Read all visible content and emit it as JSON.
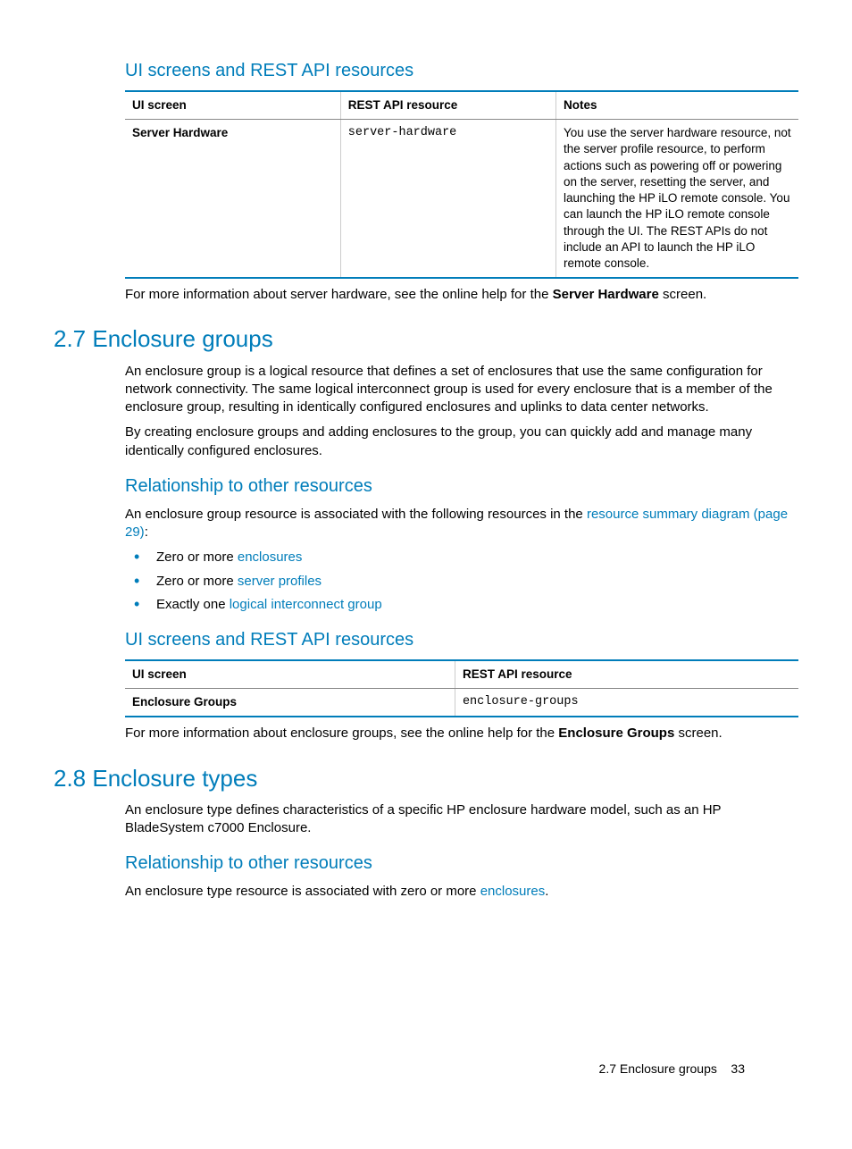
{
  "section_a": {
    "heading": "UI screens and REST API resources",
    "table": {
      "headers": [
        "UI screen",
        "REST API resource",
        "Notes"
      ],
      "row": {
        "ui": "Server Hardware",
        "api": "server-hardware",
        "notes": "You use the server hardware resource, not the server profile resource, to perform actions such as powering off or powering on the server, resetting the server, and launching the HP iLO remote console. You can launch the HP iLO remote console through the UI. The REST APIs do not include an API to launch the HP iLO remote console."
      }
    },
    "para_pre": "For more information about server hardware, see the online help for the ",
    "para_bold": "Server Hardware",
    "para_post": " screen."
  },
  "section_27": {
    "heading": "2.7 Enclosure groups",
    "p1": "An enclosure group is a logical resource that defines a set of enclosures that use the same configuration for network connectivity. The same logical interconnect group is used for every enclosure that is a member of the enclosure group, resulting in identically configured enclosures and uplinks to data center networks.",
    "p2": "By creating enclosure groups and adding enclosures to the group, you can quickly add and manage many identically configured enclosures.",
    "rel_heading": "Relationship to other resources",
    "rel_pre": "An enclosure group resource is associated with the following resources in the ",
    "rel_link": "resource summary diagram (page 29)",
    "rel_post": ":",
    "bullets": [
      {
        "pre": "Zero or more ",
        "link": "enclosures"
      },
      {
        "pre": "Zero or more ",
        "link": "server profiles"
      },
      {
        "pre": "Exactly one ",
        "link": "logical interconnect group"
      }
    ],
    "ui_heading": "UI screens and REST API resources",
    "table": {
      "headers": [
        "UI screen",
        "REST API resource"
      ],
      "row": {
        "ui": "Enclosure Groups",
        "api": "enclosure-groups"
      }
    },
    "para_pre": "For more information about enclosure groups, see the online help for the ",
    "para_bold": "Enclosure Groups",
    "para_post": " screen."
  },
  "section_28": {
    "heading": "2.8 Enclosure types",
    "p1": "An enclosure type defines characteristics of a specific HP enclosure hardware model, such as an HP BladeSystem c7000 Enclosure.",
    "rel_heading": "Relationship to other resources",
    "rel_pre": "An enclosure type resource is associated with zero or more ",
    "rel_link": "enclosures",
    "rel_post": "."
  },
  "footer": {
    "text": "2.7 Enclosure groups",
    "page": "33"
  }
}
